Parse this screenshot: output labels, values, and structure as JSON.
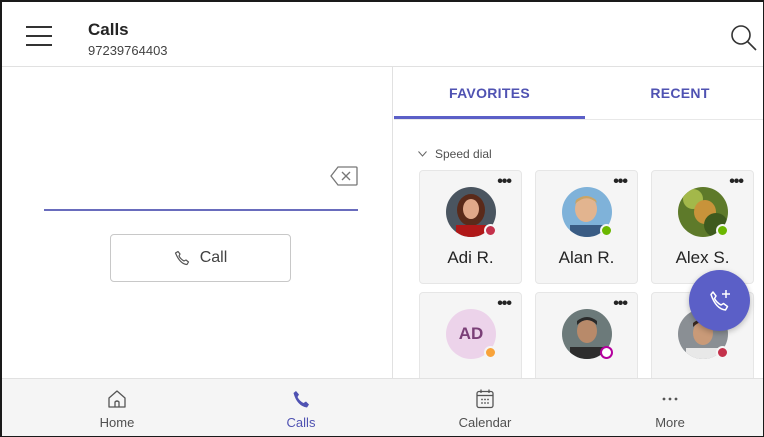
{
  "header": {
    "title": "Calls",
    "phone_number": "97239764403"
  },
  "dialer": {
    "call_button_label": "Call"
  },
  "tabs": [
    {
      "label": "FAVORITES",
      "active": true
    },
    {
      "label": "RECENT",
      "active": false
    }
  ],
  "speed_dial": {
    "label": "Speed dial",
    "contacts": [
      {
        "name": "Adi R.",
        "status": "busy",
        "status_color": "#c4314b",
        "avatar": "photo"
      },
      {
        "name": "Alan R.",
        "status": "available",
        "status_color": "#6bb700",
        "avatar": "photo"
      },
      {
        "name": "Alex S.",
        "status": "available",
        "status_color": "#6bb700",
        "avatar": "photo"
      },
      {
        "name": "",
        "initials": "AD",
        "status": "away",
        "status_color": "#f8a33a",
        "avatar": "initials"
      },
      {
        "name": "",
        "status": "out-of-office",
        "status_color": "#b4009e",
        "avatar": "photo"
      },
      {
        "name": "",
        "status": "busy",
        "status_color": "#c4314b",
        "avatar": "photo"
      }
    ]
  },
  "bottom_nav": [
    {
      "label": "Home",
      "icon": "home-icon",
      "active": false
    },
    {
      "label": "Calls",
      "icon": "phone-icon",
      "active": true
    },
    {
      "label": "Calendar",
      "icon": "calendar-icon",
      "active": false
    },
    {
      "label": "More",
      "icon": "more-icon",
      "active": false
    }
  ],
  "colors": {
    "accent": "#5b5fc7",
    "accent_text": "#4f52b2"
  }
}
